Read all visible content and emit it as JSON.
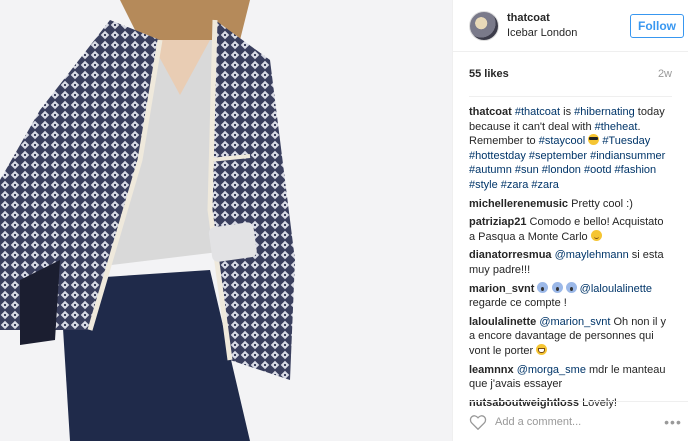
{
  "post": {
    "username": "thatcoat",
    "location": "Icebar London",
    "follow_label": "Follow",
    "likes": "55 likes",
    "age": "2w",
    "caption": {
      "user": "thatcoat",
      "p1_tag1": "#thatcoat",
      "p2": " is ",
      "p3_tag2": "#hibernating",
      "p4": " today because it can't deal with ",
      "p5_tag3": "#theheat",
      "p6": ". Remember to ",
      "p7_tag4": "#staycool",
      "p8_tags": "#Tuesday #hottestday #september #indiansummer #autumn #sun #london #ootd #fashion #style #zara #zara"
    },
    "comments": [
      {
        "user": "michellerenemusic",
        "text": "Pretty cool :)"
      },
      {
        "user": "patriziap21",
        "text": "Comodo e bello! Acquistato a Pasqua a Monte Carlo"
      },
      {
        "user": "dianatorresmua",
        "mention": "@maylehmann",
        "text": " si esta muy padre!!!"
      },
      {
        "user": "marion_svnt",
        "mention": "@laloulalinette",
        "text": "regarde ce compte !"
      },
      {
        "user": "laloulalinette",
        "mention": "@marion_svnt",
        "text": " Oh non il y a encore davantage de personnes qui vont le porter"
      },
      {
        "user": "leamnnx",
        "mention": "@morga_sme",
        "text": " mdr le manteau que j'avais essayer"
      },
      {
        "user": "nutsaboutweightloss",
        "text": "Lovely!"
      }
    ],
    "add_comment_placeholder": "Add a comment...",
    "more_label": "•••"
  },
  "icons": {
    "heart": "heart-icon",
    "more": "more-options-icon",
    "emoji_cool": "sunglasses-emoji-icon",
    "emoji_blush": "smiling-emoji-icon",
    "emoji_scream": "screaming-emoji-icon",
    "emoji_grin": "grinning-emoji-icon"
  },
  "colors": {
    "accent": "#3897f0",
    "hashtag": "#003569",
    "muted": "#999999",
    "coat_navy": "#2e3350"
  }
}
